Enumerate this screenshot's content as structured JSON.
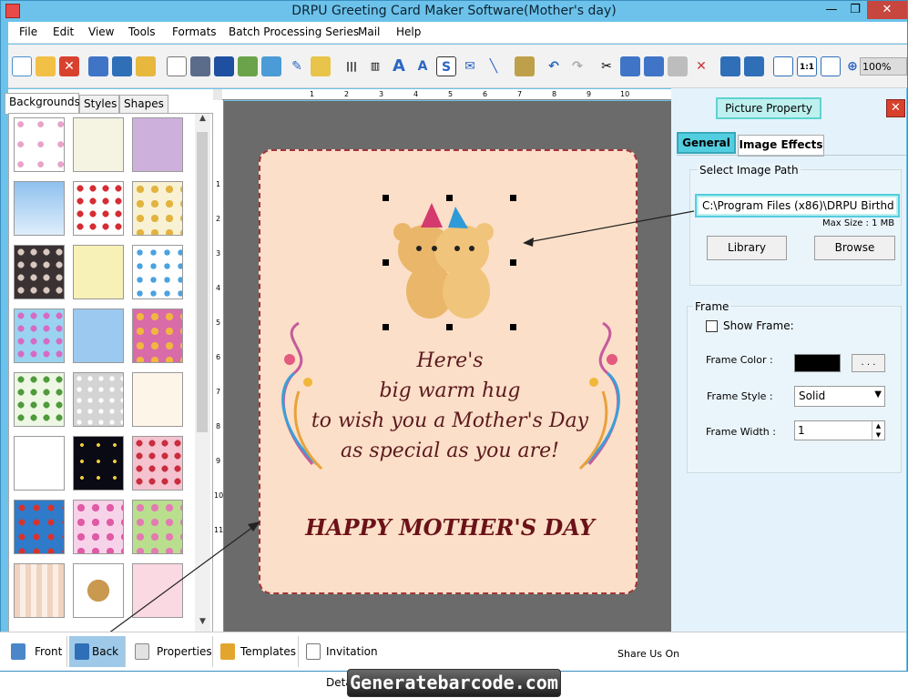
{
  "window": {
    "title": "DRPU Greeting Card Maker Software(Mother's day)",
    "min_glyph": "—",
    "max_glyph": "❐",
    "close_glyph": "✕"
  },
  "menu": [
    "File",
    "Edit",
    "View",
    "Tools",
    "Formats",
    "Batch Processing Series",
    "Mail",
    "Help"
  ],
  "toolbar": {
    "zoom": "100%"
  },
  "left_panel": {
    "tabs": [
      "Backgrounds",
      "Styles",
      "Shapes"
    ],
    "active_tab": "Backgrounds",
    "scroll_up": "▲",
    "scroll_down": "▼"
  },
  "ruler": {
    "h_marks": [
      "1",
      "2",
      "3",
      "4",
      "5",
      "6",
      "7",
      "8",
      "9",
      "10"
    ],
    "v_marks": [
      "1",
      "2",
      "3",
      "4",
      "5",
      "6",
      "7",
      "8",
      "9",
      "10",
      "11"
    ]
  },
  "card": {
    "lines": [
      "Here's",
      "big warm hug",
      "to wish you a Mother's Day",
      "as special as you are!"
    ],
    "headline": "HAPPY MOTHER'S DAY"
  },
  "right_panel": {
    "title": "Picture Property",
    "close": "✕",
    "tabs": [
      "General",
      "Image Effects"
    ],
    "select_image_path_label": "Select Image Path",
    "image_path": "C:\\Program Files (x86)\\DRPU Birthd",
    "max_size": "Max Size : 1 MB",
    "library_button": "Library",
    "browse_button": "Browse",
    "frame_group": "Frame",
    "show_frame_label": "Show Frame:",
    "frame_color_label": "Frame Color :",
    "frame_color": "#000000",
    "dots_button": ". . .",
    "frame_style_label": "Frame Style :",
    "frame_style_value": "Solid",
    "frame_width_label": "Frame Width :",
    "frame_width_value": "1"
  },
  "bottom_bar": {
    "items": [
      "Front",
      "Back",
      "Properties",
      "Templates",
      "Invitation Details"
    ],
    "active": "Back",
    "share": "Share Us On"
  },
  "watermark": "Generatebarcode.com"
}
